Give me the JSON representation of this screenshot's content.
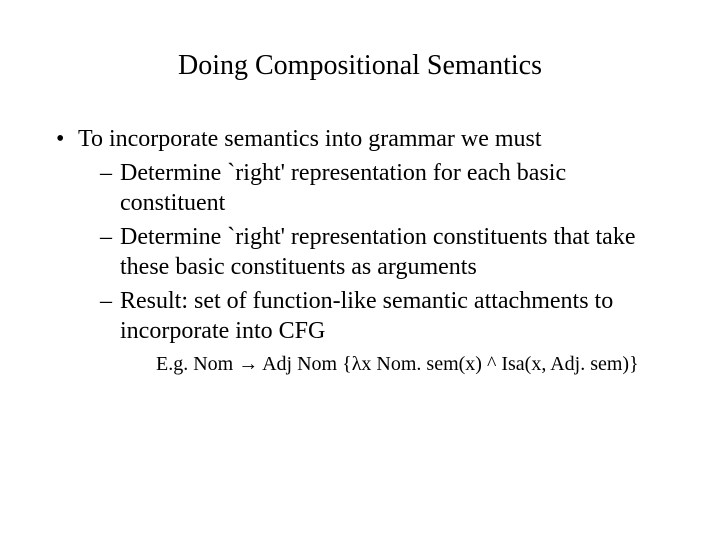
{
  "title": "Doing Compositional Semantics",
  "bullets": {
    "level1": "To incorporate semantics into grammar we must",
    "level2_a": "Determine `right' representation for each basic constituent",
    "level2_b": "Determine `right' representation constituents that take these basic constituents as arguments",
    "level2_c": "Result: set of function-like semantic attachments to incorporate into  CFG",
    "level3": "E.g. Nom → Adj Nom {λx Nom. sem(x) ^ Isa(x, Adj. sem)}"
  }
}
